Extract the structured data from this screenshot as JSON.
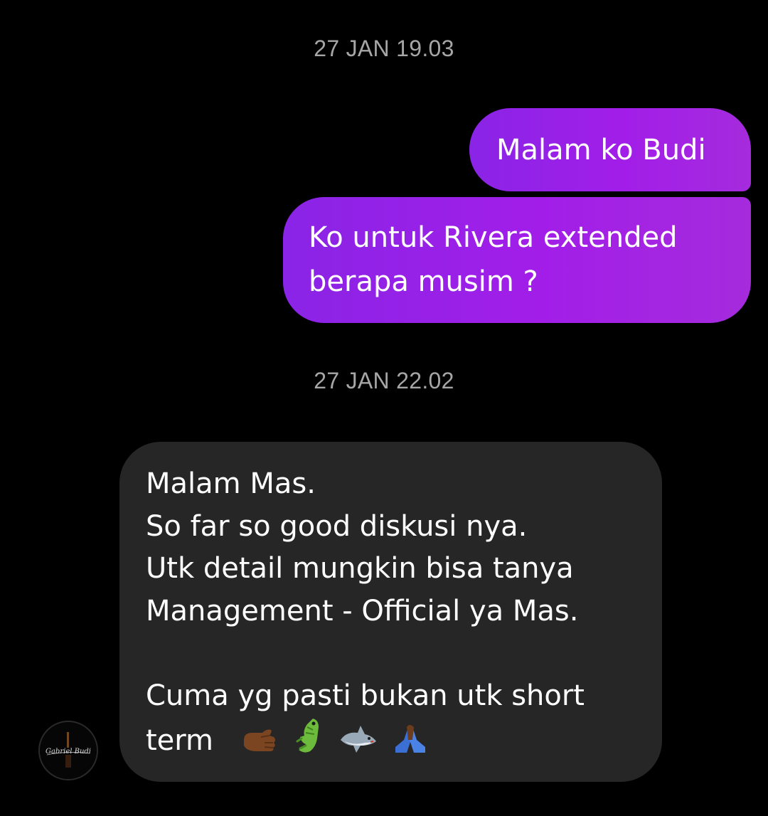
{
  "thread": {
    "timestamp_1": "27 JAN 19.03",
    "timestamp_2": "27 JAN 22.02"
  },
  "messages": {
    "out_1": "Malam ko Budi",
    "out_2_line_1": "Ko untuk Rivera extended",
    "out_2_line_2": "berapa musim ?",
    "in_1_lines": [
      "Malam Mas.",
      "So far so good diskusi nya.",
      "Utk detail mungkin bisa tanya",
      "Management - Official ya Mas.",
      "",
      "Cuma yg pasti bukan utk short",
      "term"
    ],
    "in_1_emojis": [
      "thumbs-left-icon",
      "crocodile-icon",
      "shark-icon",
      "folded-hands-icon"
    ]
  },
  "avatar": {
    "signature_text": "Gabriel Budi"
  },
  "colors": {
    "background": "#000000",
    "outgoing_bubble": "#a21ee8",
    "incoming_bubble": "#262626",
    "timestamp": "#a6a6a6"
  }
}
